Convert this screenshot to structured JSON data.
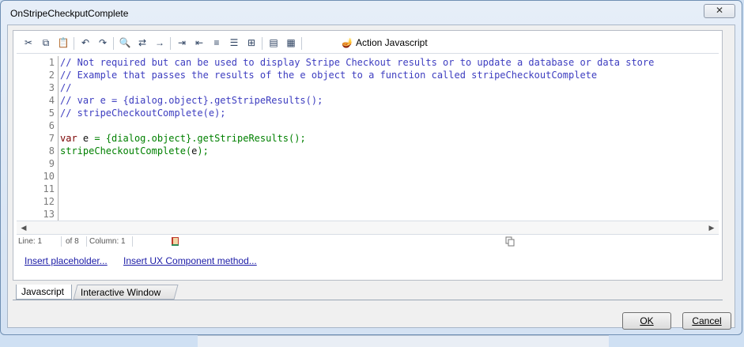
{
  "window": {
    "title": "OnStripeCheckputComplete",
    "close_label": "✕"
  },
  "toolbar": {
    "action_label": "Action Javascript"
  },
  "code": {
    "lines": [
      {
        "num": "1",
        "text": "// Not required but can be used to display Stripe Checkout results or to update a database or data store",
        "kind": "comment"
      },
      {
        "num": "2",
        "text": "// Example that passes the results of the e object to a function called stripeCheckoutComplete",
        "kind": "comment"
      },
      {
        "num": "3",
        "text": "//",
        "kind": "comment"
      },
      {
        "num": "4",
        "text": "// var e = {dialog.object}.getStripeResults();",
        "kind": "comment"
      },
      {
        "num": "5",
        "text": "// stripeCheckoutComplete(e);",
        "kind": "comment"
      },
      {
        "num": "6",
        "text": "",
        "kind": "blank"
      },
      {
        "num": "7",
        "kw": "var",
        "id": " e ",
        "code": "= {dialog.object}.getStripeResults();",
        "kind": "code"
      },
      {
        "num": "8",
        "code1": "stripeCheckoutComplete(",
        "id": "e",
        "code2": ");",
        "kind": "call"
      },
      {
        "num": "9",
        "text": "",
        "kind": "blank"
      },
      {
        "num": "10",
        "text": "",
        "kind": "blank"
      },
      {
        "num": "11",
        "text": "",
        "kind": "blank"
      },
      {
        "num": "12",
        "text": "",
        "kind": "blank"
      },
      {
        "num": "13",
        "text": "",
        "kind": "blank"
      }
    ]
  },
  "status": {
    "line": "Line: 1",
    "of": "of 8",
    "column": "Column: 1"
  },
  "links": {
    "insert_placeholder": "Insert placeholder...",
    "insert_ux_method": "Insert UX Component method..."
  },
  "tabs": {
    "javascript": "Javascript",
    "interactive": "Interactive Window"
  },
  "buttons": {
    "ok": "OK",
    "cancel": "Cancel"
  }
}
